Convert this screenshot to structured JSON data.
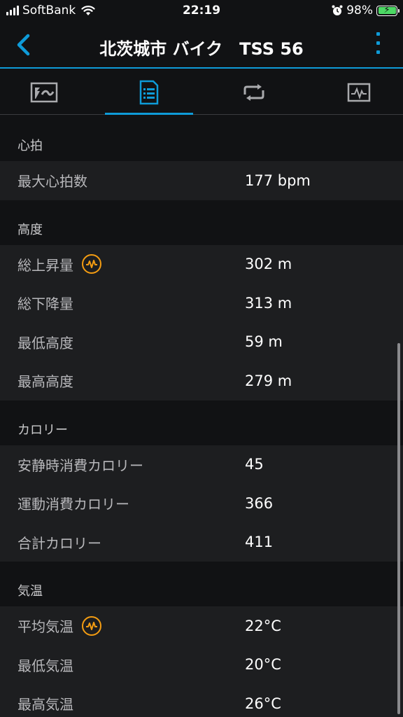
{
  "status_bar": {
    "carrier": "SoftBank",
    "time": "22:19",
    "battery": "98%"
  },
  "nav": {
    "title": "北茨城市 バイク　TSS 56"
  },
  "tabs": [
    "summary-map",
    "details",
    "laps",
    "charts"
  ],
  "sections": [
    {
      "title": "心拍",
      "rows": [
        {
          "label": "最大心拍数",
          "value": "177 bpm"
        }
      ]
    },
    {
      "title": "高度",
      "rows": [
        {
          "label": "総上昇量",
          "value": "302 m",
          "badge": true
        },
        {
          "label": "総下降量",
          "value": "313 m"
        },
        {
          "label": "最低高度",
          "value": "59 m"
        },
        {
          "label": "最高高度",
          "value": "279 m"
        }
      ]
    },
    {
      "title": "カロリー",
      "rows": [
        {
          "label": "安静時消費カロリー",
          "value": "45"
        },
        {
          "label": "運動消費カロリー",
          "value": "366"
        },
        {
          "label": "合計カロリー",
          "value": "411"
        }
      ]
    },
    {
      "title": "気温",
      "rows": [
        {
          "label": "平均気温",
          "value": "22°C",
          "badge": true
        },
        {
          "label": "最低気温",
          "value": "20°C"
        },
        {
          "label": "最高気温",
          "value": "26°C"
        }
      ]
    }
  ],
  "colors": {
    "accent": "#0e9bd8",
    "badge": "#f39c12",
    "battery": "#4cd964"
  }
}
